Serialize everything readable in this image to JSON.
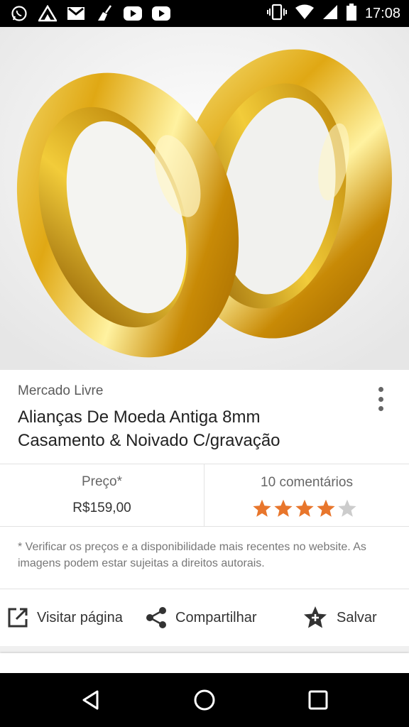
{
  "status_bar": {
    "time": "17:08",
    "left_icons": [
      "whatsapp-icon",
      "mountain-app-icon",
      "gmail-icon",
      "broom-app-icon",
      "youtube-icon",
      "youtube-icon"
    ],
    "right_icons": [
      "vibrate-icon",
      "wifi-icon",
      "signal-icon",
      "battery-icon"
    ]
  },
  "product": {
    "image_alt": "Alianças de ouro",
    "source": "Mercado Livre",
    "title": "Alianças De Moeda Antiga 8mm Casamento & Noivado C/gravação"
  },
  "price": {
    "label": "Preço*",
    "value": "R$159,00"
  },
  "reviews": {
    "label": "10 comentários",
    "rating": 4,
    "max": 5,
    "star_color": "#e8762c",
    "empty_star_color": "#cccccc"
  },
  "disclaimer": "* Verificar os preços e a disponibilidade mais recentes no website. As imagens podem estar sujeitas a direitos autorais.",
  "actions": {
    "visit": "Visitar página",
    "share": "Compartilhar",
    "save": "Salvar"
  },
  "nav": [
    "back-icon",
    "home-icon",
    "recents-icon"
  ]
}
